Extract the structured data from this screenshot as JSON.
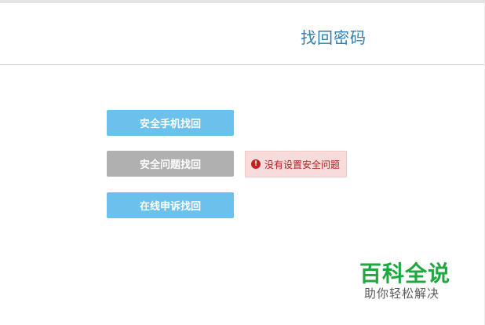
{
  "header": {
    "title": "找回密码"
  },
  "options": {
    "phone_label": "安全手机找回",
    "question_label": "安全问题找回",
    "appeal_label": "在线申诉找回"
  },
  "error": {
    "icon": "exclamation-circle-icon",
    "text": "没有设置安全问题"
  },
  "watermark": {
    "brand": "百科全说",
    "slogan": "助你轻松解决"
  },
  "colors": {
    "title": "#2e7fb3",
    "button_active": "#6cc1ec",
    "button_disabled": "#b0b0b0",
    "error_bg": "#f8dcdc",
    "error_text": "#b02222",
    "watermark": "#1fa83f"
  }
}
